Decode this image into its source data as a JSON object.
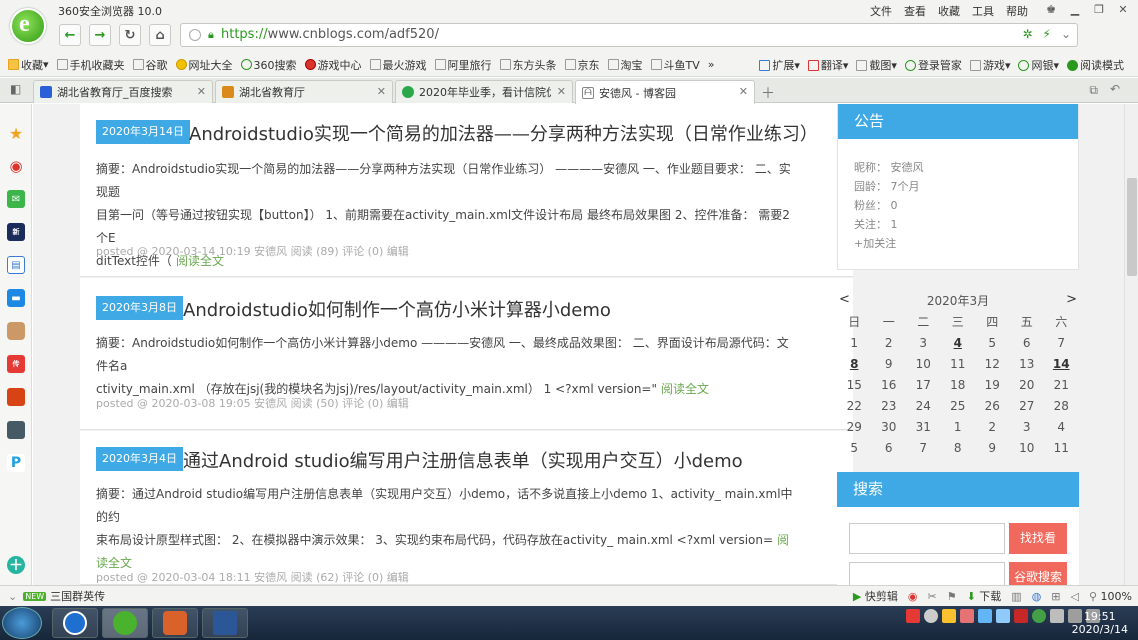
{
  "window": {
    "title": "360安全浏览器 10.0"
  },
  "menu": [
    "文件",
    "查看",
    "收藏",
    "工具",
    "帮助"
  ],
  "address": {
    "url_prefix": "https://",
    "url_host": "www.cnblogs.com",
    "url_path": "/adf520/"
  },
  "bookmarks": {
    "left": [
      "收藏",
      "手机收藏夹",
      "谷歌",
      "网址大全",
      "360搜索",
      "游戏中心",
      "最火游戏",
      "阿里旅行",
      "东方头条",
      "京东",
      "淘宝",
      "斗鱼TV",
      "»"
    ],
    "right": [
      "扩展",
      "翻译",
      "截图",
      "登录管家",
      "游戏",
      "网银",
      "阅读模式"
    ]
  },
  "tabs": [
    {
      "label": "湖北省教育厅_百度搜索",
      "color": "#2b5fd8"
    },
    {
      "label": "湖北省教育厅",
      "color": "#d98a1a"
    },
    {
      "label": "2020年毕业季，看计信院优秀",
      "color": "#2aa84a"
    },
    {
      "label": "安德风 - 博客园",
      "color": "#888888"
    }
  ],
  "posts": [
    {
      "date": "2020年3月14日",
      "title": "Androidstudio实现一个简易的加法器——分享两种方法实现（日常作业练习）",
      "summary_lines": [
        "摘要：Androidstudio实现一个简易的加法器——分享两种方法实现（日常作业练习） ————安德风 一、作业题目要求： 二、实现题",
        "目第一问（等号通过按钮实现【button】） 1、前期需要在activity_main.xml文件设计布局 最终布局效果图 2、控件准备： 需要2个E",
        "ditText控件（"
      ],
      "more": "阅读全文",
      "footer": "posted @ 2020-03-14 10:19 安德风 阅读 (89) 评论 (0) 编辑"
    },
    {
      "date": "2020年3月8日",
      "title": "Androidstudio如何制作一个高仿小米计算器小demo",
      "summary_lines": [
        "摘要：Androidstudio如何制作一个高仿小米计算器小demo ————安德风 一、最终成品效果图： 二、界面设计布局源代码：文件名a",
        "ctivity_main.xml （存放在jsj(我的模块名为jsj)/res/layout/activity_main.xml） 1 <?xml version=\""
      ],
      "more": "阅读全文",
      "footer": "posted @ 2020-03-08 19:05 安德风 阅读 (50) 评论 (0) 编辑"
    },
    {
      "date": "2020年3月4日",
      "title": "通过Android studio编写用户注册信息表单（实现用户交互）小demo",
      "summary_lines": [
        "摘要：通过Android studio编写用户注册信息表单（实现用户交互）小demo，话不多说直接上小demo 1、activity_ main.xml中的约",
        "束布局设计原型样式图： 2、在模拟器中演示效果： 3、实现约束布局代码，代码存放在activity_ main.xml <?xml version="
      ],
      "more": "阅读全文",
      "footer": "posted @ 2020-03-04 18:11 安德风 阅读 (62) 评论 (0) 编辑"
    }
  ],
  "notice": {
    "title": "公告",
    "lines": [
      "昵称： 安德风",
      "园龄： 7个月",
      "粉丝： 0",
      "关注： 1",
      "+加关注"
    ]
  },
  "calendar": {
    "title": "2020年3月",
    "prev": "<",
    "next": ">",
    "weekdays": [
      "日",
      "一",
      "二",
      "三",
      "四",
      "五",
      "六"
    ],
    "rows": [
      [
        "1",
        "2",
        "3",
        "4",
        "5",
        "6",
        "7"
      ],
      [
        "8",
        "9",
        "10",
        "11",
        "12",
        "13",
        "14"
      ],
      [
        "15",
        "16",
        "17",
        "18",
        "19",
        "20",
        "21"
      ],
      [
        "22",
        "23",
        "24",
        "25",
        "26",
        "27",
        "28"
      ],
      [
        "29",
        "30",
        "31",
        "1",
        "2",
        "3",
        "4"
      ],
      [
        "5",
        "6",
        "7",
        "8",
        "9",
        "10",
        "11"
      ]
    ],
    "bold": [
      "4",
      "8",
      "14"
    ]
  },
  "search": {
    "title": "搜索",
    "btn1": "找找看",
    "btn2": "谷歌搜索"
  },
  "statusbar": {
    "badge": "NEW",
    "news": "三国群英传",
    "right": [
      "快剪辑",
      "下载",
      "100%"
    ]
  },
  "clock": {
    "time": "19:51",
    "date": "2020/3/14"
  }
}
